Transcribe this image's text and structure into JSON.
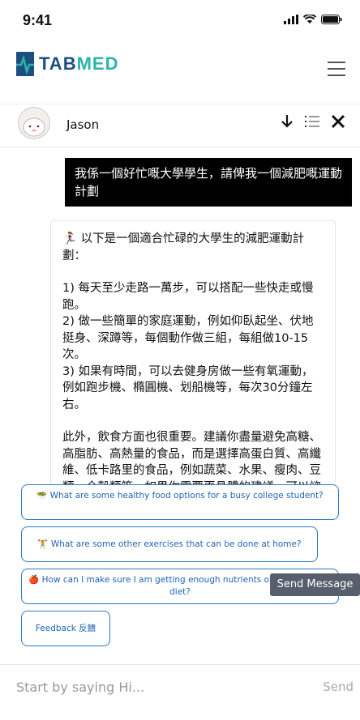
{
  "status": {
    "time": "9:41"
  },
  "header": {
    "brand_main": "TAB",
    "brand_accent": "MED"
  },
  "chat": {
    "bot_name": "Jason"
  },
  "user_message": "我係一個好忙嘅大學學生，請俾我一個減肥嘅運動計劃",
  "bot_message": {
    "emoji": "🏃‍♀️",
    "intro": "以下是一個適合忙碌的大學生的減肥運動計劃：",
    "items": [
      "1) 每天至少走路一萬步，可以搭配一些快走或慢跑。",
      "2) 做一些簡單的家庭運動，例如仰臥起坐、伏地挺身、深蹲等，每個動作做三組，每組做10-15次。",
      "3) 如果有時間，可以去健身房做一些有氧運動，例如跑步機、橢圓機、划船機等，每次30分鐘左右。"
    ],
    "outro": "此外，飲食方面也很重要。建議你盡量避免高糖、高脂肪、高熱量的食品，而是選擇高蛋白質、高纖維、低卡路里的食品，例如蔬菜、水果、瘦肉、豆類、全穀類等。如果你需要更具體的建議，可以諮詢營養師。"
  },
  "suggestions": [
    {
      "icon": "🥗",
      "text": "What are some healthy food options for a busy college student?"
    },
    {
      "icon": "🏋️",
      "text": "What are some other exercises that can be done at home?"
    },
    {
      "icon": "🍎",
      "text": "How can I make sure I am getting enough nutrients on a low-calorie diet?"
    }
  ],
  "feedback_label": "Feedback 反饋",
  "tooltip": "Send Message",
  "composer": {
    "placeholder": "Start by saying Hi...",
    "send_label": "Send"
  },
  "colors": {
    "brand": "#1b4f80",
    "accent": "#2bb5a8",
    "suggestion": "#2a79c9"
  }
}
